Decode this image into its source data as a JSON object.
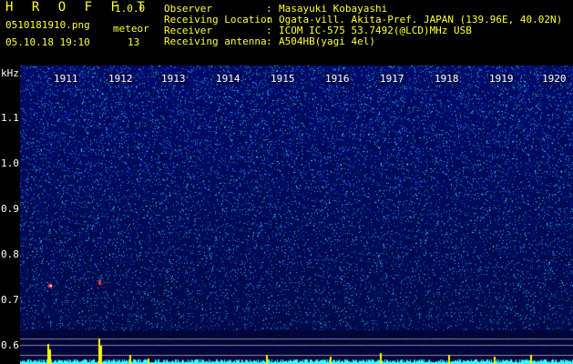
{
  "header": {
    "app_title": "H R O F F T",
    "app_version": "1.0.0",
    "filename": "0510181910.png",
    "datetime": "05.10.18 19:10",
    "meteor_label": "meteor",
    "meteor_count": "13"
  },
  "info": [
    {
      "label": "Observer",
      "value": "Masayuki Kobayashi"
    },
    {
      "label": "Receiving Location",
      "value": "Ogata-vill. Akita-Pref. JAPAN (139.96E, 40.02N)"
    },
    {
      "label": "Receiver",
      "value": "ICOM IC-575 53.7492(@LCD)MHz USB"
    },
    {
      "label": "Receiving antenna",
      "value": "A504HB(yagi 4el)"
    }
  ],
  "axis": {
    "y_unit": "kHz",
    "y_ticks": [
      "1.1",
      "1.0",
      "0.9",
      "0.8",
      "0.7",
      "0.6"
    ],
    "x_ticks": [
      "1911",
      "1912",
      "1913",
      "1914",
      "1915",
      "1916",
      "1917",
      "1918",
      "1919",
      "1920"
    ]
  },
  "colors": {
    "background": "#000000",
    "header_text": "#ffff33",
    "spectrogram_base": "#0a1a8c",
    "noise_line": "#33ffff",
    "meteor_signal": "#ffff00"
  }
}
